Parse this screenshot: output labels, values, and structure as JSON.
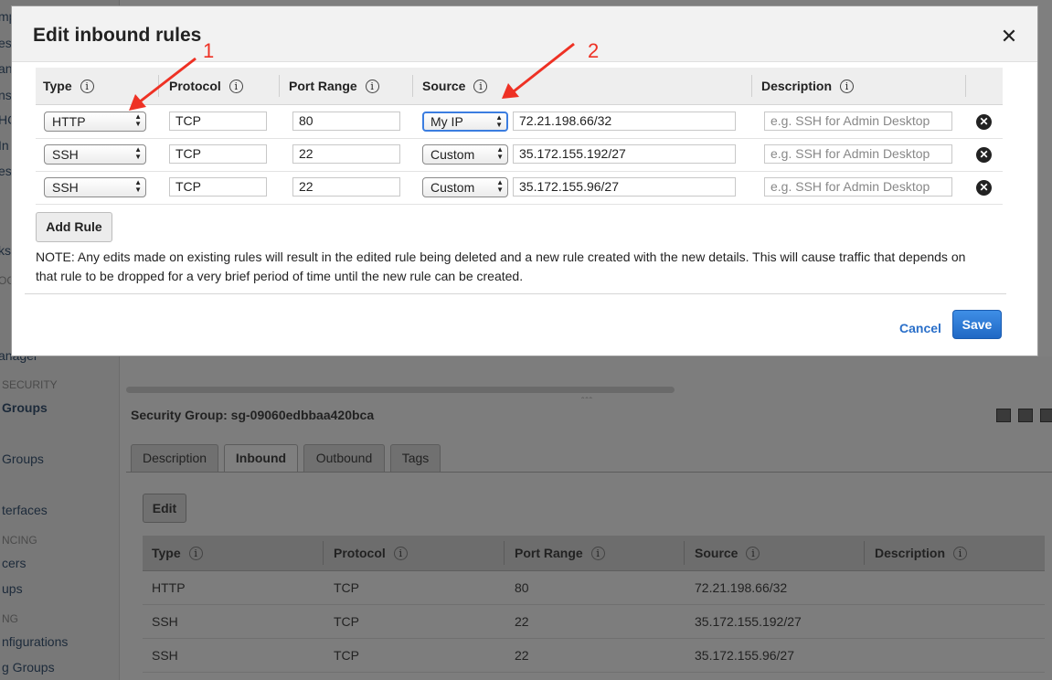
{
  "sidebar": {
    "items": [
      "mp",
      "es",
      "an",
      "ns",
      "HC",
      "In",
      "es",
      "ks",
      "OC",
      "anager",
      "Groups",
      "Groups",
      "terfaces",
      "cers",
      "ups",
      "nfigurations",
      "g Groups"
    ],
    "sections": [
      "SECURITY",
      "NCING",
      "NG"
    ]
  },
  "detail": {
    "drag_handle": "ˆˆˆ",
    "title": "Security Group: sg-09060edbbaa420bca",
    "tabs": [
      "Description",
      "Inbound",
      "Outbound",
      "Tags"
    ],
    "active_tab": "Inbound",
    "edit_label": "Edit",
    "columns": [
      "Type",
      "Protocol",
      "Port Range",
      "Source",
      "Description"
    ],
    "rows": [
      [
        "HTTP",
        "TCP",
        "80",
        "72.21.198.66/32",
        ""
      ],
      [
        "SSH",
        "TCP",
        "22",
        "35.172.155.192/27",
        ""
      ],
      [
        "SSH",
        "TCP",
        "22",
        "35.172.155.96/27",
        ""
      ]
    ]
  },
  "modal": {
    "title": "Edit inbound rules",
    "close_glyph": "✕",
    "info_glyph": "i",
    "columns": [
      "Type",
      "Protocol",
      "Port Range",
      "Source",
      "Description"
    ],
    "rules": [
      {
        "type": "HTTP",
        "protocol": "TCP",
        "port": "80",
        "source_type": "My IP",
        "source": "72.21.198.66/32",
        "description_placeholder": "e.g. SSH for Admin Desktop"
      },
      {
        "type": "SSH",
        "protocol": "TCP",
        "port": "22",
        "source_type": "Custom",
        "source": "35.172.155.192/27",
        "description_placeholder": "e.g. SSH for Admin Desktop"
      },
      {
        "type": "SSH",
        "protocol": "TCP",
        "port": "22",
        "source_type": "Custom",
        "source": "35.172.155.96/27",
        "description_placeholder": "e.g. SSH for Admin Desktop"
      }
    ],
    "add_rule_label": "Add Rule",
    "note": "NOTE: Any edits made on existing rules will result in the edited rule being deleted and a new rule created with the new details. This will cause traffic that depends on that rule to be dropped for a very brief period of time until the new rule can be created.",
    "cancel_label": "Cancel",
    "save_label": "Save"
  },
  "annotations": {
    "arrow1_label": "1",
    "arrow2_label": "2",
    "color": "#ee3124"
  },
  "colors": {
    "primary": "#1f68c4",
    "link": "#2a6fc9",
    "focus": "#3b7de0"
  }
}
